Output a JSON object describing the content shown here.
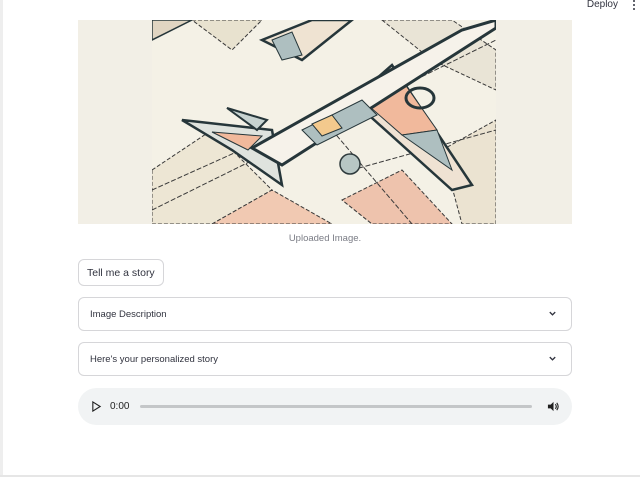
{
  "header": {
    "deploy_label": "Deploy"
  },
  "image": {
    "caption": "Uploaded Image."
  },
  "actions": {
    "story_button_label": "Tell me a story"
  },
  "expanders": {
    "description_label": "Image Description",
    "story_label": "Here's your personalized story"
  },
  "audio": {
    "time": "0:00",
    "progress": 0
  },
  "colors": {
    "border": "#d6d6d9",
    "text": "#31333f",
    "audio_bg": "#f1f3f4",
    "image_bg": "#f2efe6"
  },
  "icons": {
    "menu": "menu-dots-icon",
    "chevron": "chevron-down-icon",
    "play": "play-icon",
    "volume": "volume-icon"
  }
}
